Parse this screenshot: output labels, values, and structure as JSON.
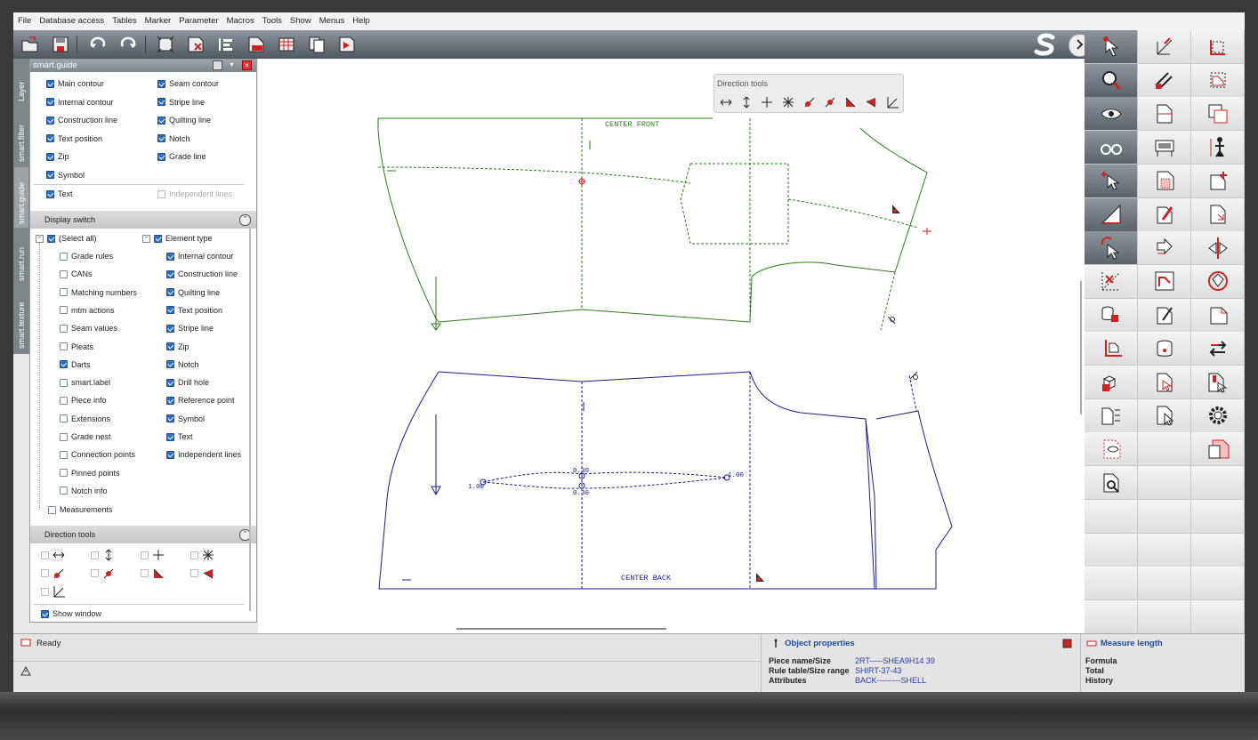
{
  "menu": [
    "File",
    "Database access",
    "Tables",
    "Marker",
    "Parameter",
    "Macros",
    "Tools",
    "Show",
    "Menus",
    "Help"
  ],
  "toolbar_icons": [
    "open-icon",
    "save-icon",
    "undo-icon",
    "redo-icon",
    "frame-icon",
    "delete-piece-icon",
    "align-icon",
    "piece-info-icon",
    "table-icon",
    "copy-icon",
    "play-icon"
  ],
  "left_tabs": [
    "Layer",
    "smart.filter",
    "smart.guide",
    "smart.run",
    "smart.texture"
  ],
  "panel": {
    "title": "smart.guide",
    "top_items": [
      {
        "label": "Main contour",
        "checked": true
      },
      {
        "label": "Seam contour",
        "checked": true
      },
      {
        "label": "Internal contour",
        "checked": true
      },
      {
        "label": "Stripe line",
        "checked": true
      },
      {
        "label": "Construction line",
        "checked": true
      },
      {
        "label": "Quilting line",
        "checked": true
      },
      {
        "label": "Text position",
        "checked": true
      },
      {
        "label": "Notch",
        "checked": true
      },
      {
        "label": "Zip",
        "checked": true
      },
      {
        "label": "Grade line",
        "checked": true
      },
      {
        "label": "Symbol",
        "checked": true
      },
      {
        "label": "Text",
        "checked": true
      },
      {
        "label": "Independent lines",
        "checked": false,
        "disabled": true
      }
    ],
    "display_switch_title": "Display switch",
    "left_tree_root": {
      "label": "(Select all)",
      "checked": true
    },
    "left_tree": [
      {
        "label": "Grade rules",
        "checked": false
      },
      {
        "label": "CANs",
        "checked": false
      },
      {
        "label": "Matching numbers",
        "checked": false
      },
      {
        "label": "mtm actions",
        "checked": false
      },
      {
        "label": "Seam values",
        "checked": false
      },
      {
        "label": "Pleats",
        "checked": false
      },
      {
        "label": "Darts",
        "checked": true
      },
      {
        "label": "smart.label",
        "checked": false
      },
      {
        "label": "Piece info",
        "checked": false
      },
      {
        "label": "Extensions",
        "checked": false
      },
      {
        "label": "Grade nest",
        "checked": false
      },
      {
        "label": "Connection points",
        "checked": false
      },
      {
        "label": "Pinned points",
        "checked": false
      },
      {
        "label": "Notch info",
        "checked": false
      }
    ],
    "measurements": {
      "label": "Measurements",
      "checked": false
    },
    "right_tree_root": {
      "label": "Element type",
      "checked": true
    },
    "right_tree": [
      {
        "label": "Internal contour",
        "checked": true
      },
      {
        "label": "Construction line",
        "checked": true
      },
      {
        "label": "Quilting line",
        "checked": true
      },
      {
        "label": "Text position",
        "checked": true
      },
      {
        "label": "Stripe line",
        "checked": true
      },
      {
        "label": "Zip",
        "checked": true
      },
      {
        "label": "Notch",
        "checked": true
      },
      {
        "label": "Drill hole",
        "checked": true
      },
      {
        "label": "Reference point",
        "checked": true
      },
      {
        "label": "Symbol",
        "checked": true
      },
      {
        "label": "Text",
        "checked": true
      },
      {
        "label": "Independent lines",
        "checked": true
      }
    ],
    "direction_tools_title": "Direction tools",
    "show_window": {
      "label": "Show window",
      "checked": true
    }
  },
  "canvas": {
    "direction_tools_popup_title": "Direction tools",
    "front_label": "CENTER FRONT",
    "back_label": "CENTER BACK",
    "dart_values": [
      "0.30",
      "0.30",
      "1.00",
      "1.00"
    ]
  },
  "status": {
    "ready": "Ready",
    "object_properties": {
      "title": "Object properties",
      "rows": [
        {
          "label": "Piece name/Size",
          "value": "2RT-----SHEA9H14 39"
        },
        {
          "label": "Rule table/Size range",
          "value": "SHIRT-37-43"
        },
        {
          "label": "Attributes",
          "value": "BACK---------SHELL"
        }
      ]
    },
    "measure": {
      "title": "Measure length",
      "rows": [
        "Formula",
        "Total",
        "History"
      ]
    }
  },
  "colors": {
    "front": "#2d7a1c",
    "back": "#1c1c8a",
    "accent": "#c0202a"
  }
}
